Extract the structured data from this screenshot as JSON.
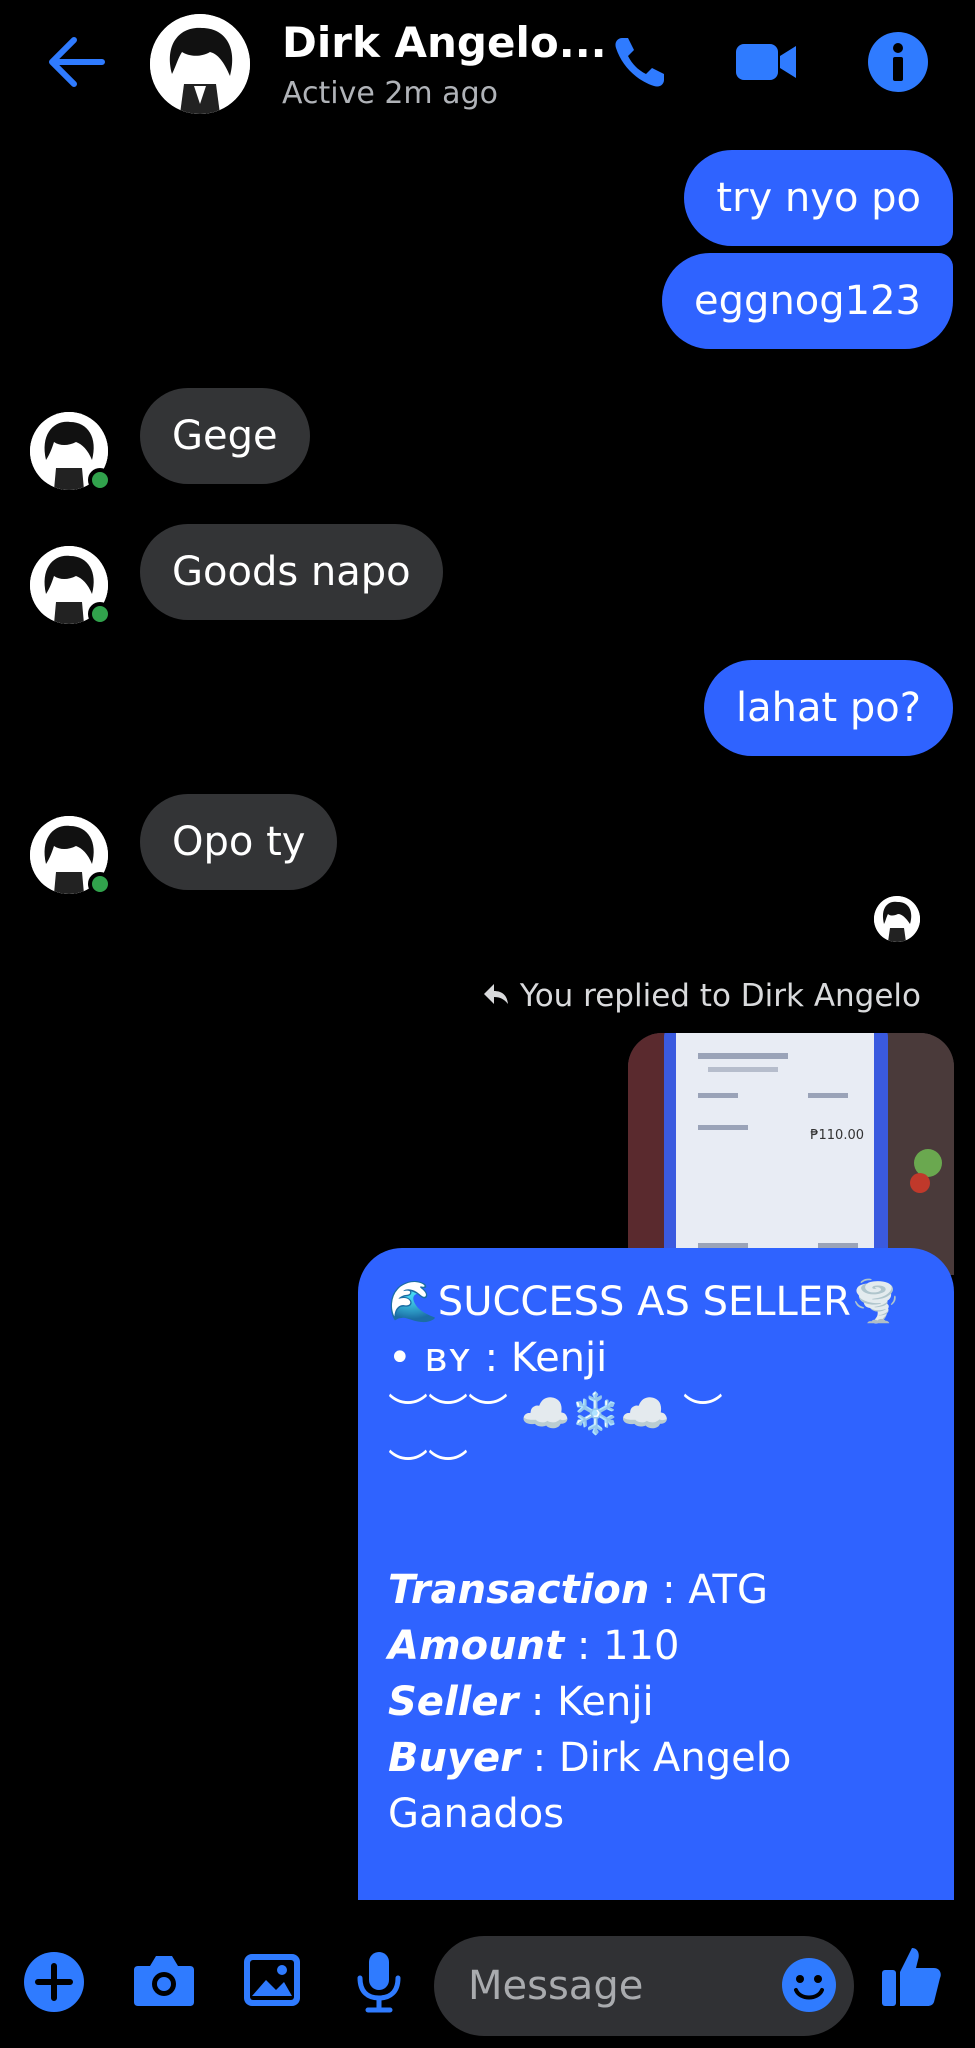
{
  "header": {
    "contact_name": "Dirk Angelo...",
    "status": "Active 2m ago"
  },
  "messages": [
    {
      "side": "out",
      "text": "try nyo po"
    },
    {
      "side": "out",
      "text": "eggnog123"
    },
    {
      "side": "in",
      "text": "Gege"
    },
    {
      "side": "in",
      "text": "Goods napo"
    },
    {
      "side": "out",
      "text": "lahat po?"
    },
    {
      "side": "in",
      "text": "Opo ty"
    }
  ],
  "reply_notice": "You replied to Dirk Angelo",
  "reply_preview": {
    "amount_text": "₱110.00"
  },
  "card": {
    "title": "🌊SUCCESS AS SELLER🌪️",
    "by_line": "• ʙʏ : Kenji",
    "deco1": "︶︶︶ ☁️❄️☁️ ︶",
    "deco2": "︶︶",
    "rows": [
      {
        "label": "Transaction",
        "value": " : ATG"
      },
      {
        "label": "Amount",
        "value": " : 110"
      },
      {
        "label": "Seller",
        "value": " : Kenji"
      },
      {
        "label": "Buyer",
        "value": " : Dirk Angelo"
      }
    ],
    "buyer_cont": "Ganados"
  },
  "composer": {
    "placeholder": "Message"
  },
  "colors": {
    "accent": "#2f63ff",
    "incoming": "#333436",
    "online": "#31a24c"
  }
}
